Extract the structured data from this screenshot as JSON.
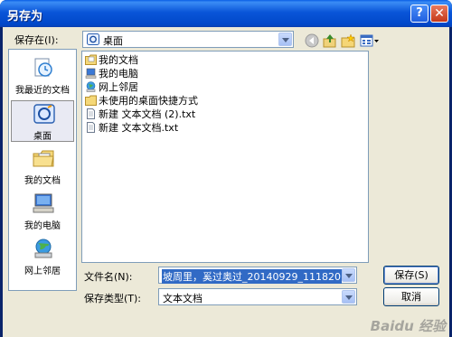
{
  "window": {
    "title": "另存为",
    "help_icon": "?",
    "close_icon": "✕"
  },
  "save_in": {
    "label": "保存在(I):",
    "value": "桌面"
  },
  "toolbar": {
    "back_icon": "back-icon",
    "up_icon": "up-folder-icon",
    "new_folder_icon": "new-folder-icon",
    "views_icon": "views-menu-icon"
  },
  "places": [
    {
      "label": "我最近的文档",
      "icon": "recent-docs-icon"
    },
    {
      "label": "桌面",
      "icon": "desktop-icon",
      "selected": true
    },
    {
      "label": "我的文档",
      "icon": "my-docs-icon"
    },
    {
      "label": "我的电脑",
      "icon": "my-computer-icon"
    },
    {
      "label": "网上邻居",
      "icon": "network-icon"
    }
  ],
  "files": [
    {
      "name": "我的文档",
      "icon": "my-docs-icon"
    },
    {
      "name": "我的电脑",
      "icon": "my-computer-icon"
    },
    {
      "name": "网上邻居",
      "icon": "network-icon"
    },
    {
      "name": "未使用的桌面快捷方式",
      "icon": "folder-icon"
    },
    {
      "name": "新建 文本文档 (2).txt",
      "icon": "text-file-icon"
    },
    {
      "name": "新建 文本文档.txt",
      "icon": "text-file-icon"
    }
  ],
  "filename": {
    "label": "文件名(N):",
    "value": "坡周里，奚过奥过_20140929_111820"
  },
  "filetype": {
    "label": "保存类型(T):",
    "value": "文本文档"
  },
  "buttons": {
    "save": "保存(S)",
    "cancel": "取消"
  },
  "watermark": "Baidu 经验"
}
